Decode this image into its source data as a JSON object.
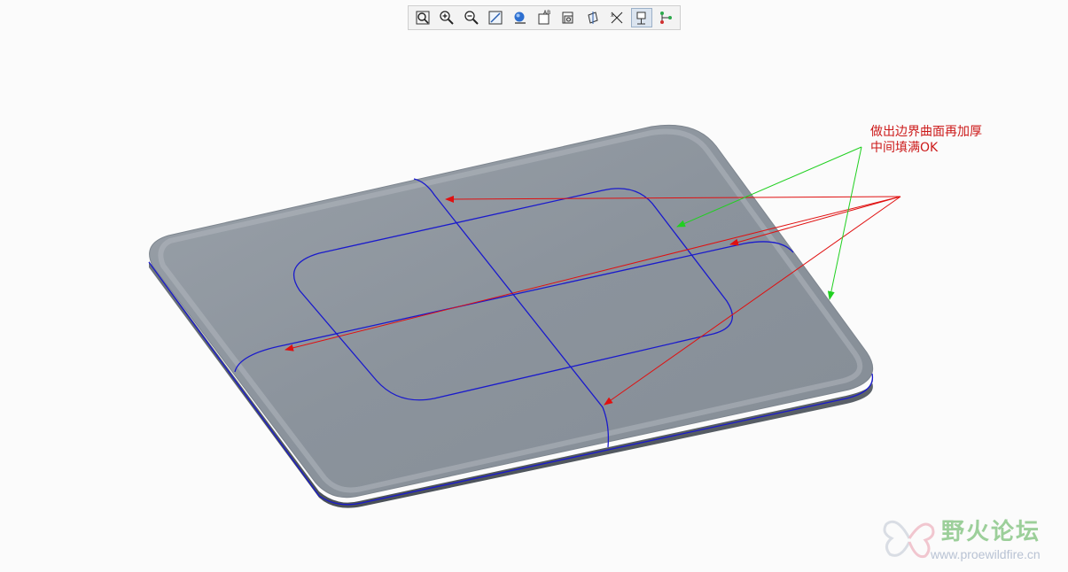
{
  "toolbar": {
    "buttons": [
      {
        "name": "refit-view-icon"
      },
      {
        "name": "zoom-in-icon"
      },
      {
        "name": "zoom-out-icon"
      },
      {
        "name": "repaint-icon"
      },
      {
        "name": "display-style-icon"
      },
      {
        "name": "saved-views-icon"
      },
      {
        "name": "layers-icon"
      },
      {
        "name": "datum-planes-icon"
      },
      {
        "name": "datum-axes-icon"
      },
      {
        "name": "datum-points-icon",
        "active": true
      },
      {
        "name": "coordinate-systems-icon"
      }
    ]
  },
  "annotation": {
    "line1": "做出边界曲面再加厚",
    "line2": "中间填满OK"
  },
  "colors": {
    "background": "#fbfbfb",
    "part_surface": "#8a929b",
    "edge_curve": "#1a1acc",
    "red_arrow": "#cc1a1a",
    "green_arrow": "#22cc22",
    "annotation_text": "#cc1a1a"
  },
  "watermark": {
    "title": "野火论坛",
    "url": "www.proewildfire.cn"
  }
}
